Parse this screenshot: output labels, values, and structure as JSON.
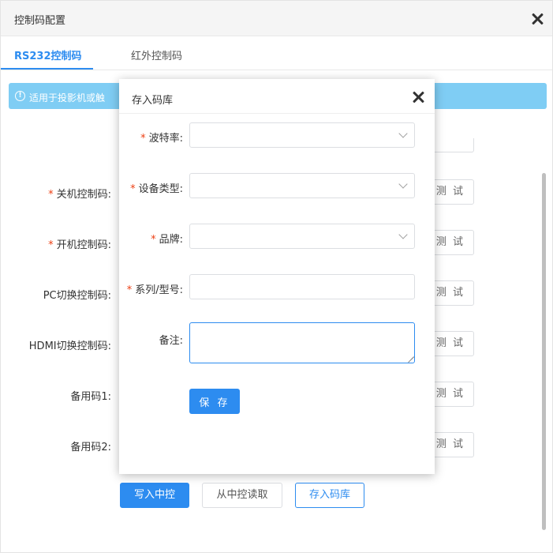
{
  "window": {
    "title": "控制码配置"
  },
  "tabs": [
    {
      "label": "RS232控制码",
      "active": true
    },
    {
      "label": "红外控制码",
      "active": false
    }
  ],
  "alert": {
    "text": "适用于投影机或触"
  },
  "form_rows": [
    {
      "label": "关机控制码:",
      "required": true,
      "test_label": "测 试"
    },
    {
      "label": "开机控制码:",
      "required": true,
      "test_label": "测 试"
    },
    {
      "label": "PC切换控制码:",
      "required": false,
      "test_label": "测 试"
    },
    {
      "label": "HDMI切换控制码:",
      "required": false,
      "test_label": "测 试"
    },
    {
      "label": "备用码1:",
      "required": false,
      "test_label": "测 试"
    },
    {
      "label": "备用码2:",
      "required": false,
      "test_label": "测 试"
    }
  ],
  "actions": {
    "write_label": "写入中控",
    "read_label": "从中控读取",
    "store_label": "存入码库"
  },
  "modal": {
    "title": "存入码库",
    "fields": [
      {
        "label": "波特率:",
        "required": true,
        "kind": "select",
        "value": ""
      },
      {
        "label": "设备类型:",
        "required": true,
        "kind": "select",
        "value": ""
      },
      {
        "label": "品牌:",
        "required": true,
        "kind": "select",
        "value": ""
      },
      {
        "label": "系列/型号:",
        "required": true,
        "kind": "input",
        "value": ""
      },
      {
        "label": "备注:",
        "required": false,
        "kind": "textarea",
        "value": ""
      }
    ],
    "save_label": "保 存"
  },
  "colors": {
    "primary": "#2d8cf0",
    "alert_bg": "#7fcdf4",
    "required": "#ed4014"
  }
}
